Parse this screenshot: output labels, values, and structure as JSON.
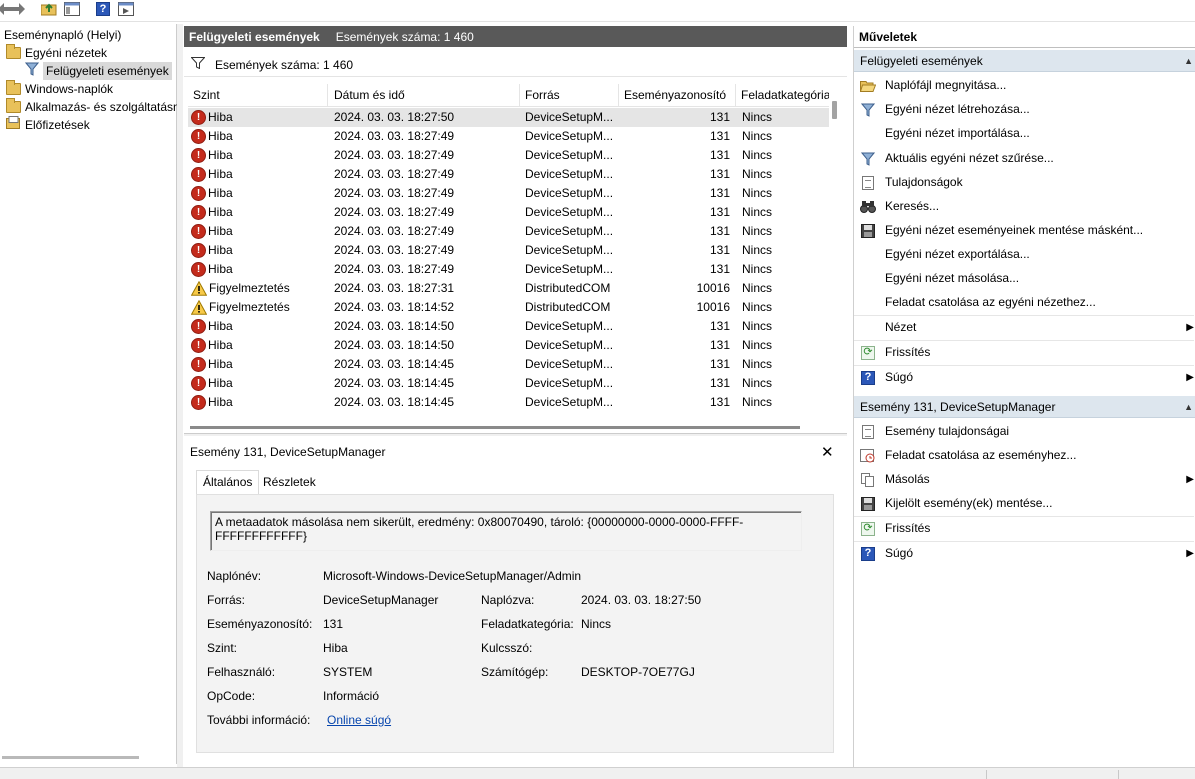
{
  "tree": {
    "items": [
      {
        "label": "Eseménynapló (Helyi)"
      },
      {
        "label": "Egyéni nézetek"
      },
      {
        "label": "Felügyeleti események"
      },
      {
        "label": "Windows-naplók"
      },
      {
        "label": "Alkalmazás- és szolgáltatásn"
      },
      {
        "label": "Előfizetések"
      }
    ]
  },
  "center": {
    "title": "Felügyeleti események",
    "count": "Események száma: 1 460",
    "filter_text": "Események száma: 1 460"
  },
  "events": {
    "columns": [
      "Szint",
      "Dátum és idő",
      "Forrás",
      "Eseményazonosító",
      "Feladatkategória"
    ],
    "rows": [
      {
        "level": "Hiba",
        "type": "error",
        "date": "2024. 03. 03. 18:27:50",
        "source": "DeviceSetupM...",
        "id": "131",
        "task": "Nincs"
      },
      {
        "level": "Hiba",
        "type": "error",
        "date": "2024. 03. 03. 18:27:49",
        "source": "DeviceSetupM...",
        "id": "131",
        "task": "Nincs"
      },
      {
        "level": "Hiba",
        "type": "error",
        "date": "2024. 03. 03. 18:27:49",
        "source": "DeviceSetupM...",
        "id": "131",
        "task": "Nincs"
      },
      {
        "level": "Hiba",
        "type": "error",
        "date": "2024. 03. 03. 18:27:49",
        "source": "DeviceSetupM...",
        "id": "131",
        "task": "Nincs"
      },
      {
        "level": "Hiba",
        "type": "error",
        "date": "2024. 03. 03. 18:27:49",
        "source": "DeviceSetupM...",
        "id": "131",
        "task": "Nincs"
      },
      {
        "level": "Hiba",
        "type": "error",
        "date": "2024. 03. 03. 18:27:49",
        "source": "DeviceSetupM...",
        "id": "131",
        "task": "Nincs"
      },
      {
        "level": "Hiba",
        "type": "error",
        "date": "2024. 03. 03. 18:27:49",
        "source": "DeviceSetupM...",
        "id": "131",
        "task": "Nincs"
      },
      {
        "level": "Hiba",
        "type": "error",
        "date": "2024. 03. 03. 18:27:49",
        "source": "DeviceSetupM...",
        "id": "131",
        "task": "Nincs"
      },
      {
        "level": "Hiba",
        "type": "error",
        "date": "2024. 03. 03. 18:27:49",
        "source": "DeviceSetupM...",
        "id": "131",
        "task": "Nincs"
      },
      {
        "level": "Figyelmeztetés",
        "type": "warning",
        "date": "2024. 03. 03. 18:27:31",
        "source": "DistributedCOM",
        "id": "10016",
        "task": "Nincs"
      },
      {
        "level": "Figyelmeztetés",
        "type": "warning",
        "date": "2024. 03. 03. 18:14:52",
        "source": "DistributedCOM",
        "id": "10016",
        "task": "Nincs"
      },
      {
        "level": "Hiba",
        "type": "error",
        "date": "2024. 03. 03. 18:14:50",
        "source": "DeviceSetupM...",
        "id": "131",
        "task": "Nincs"
      },
      {
        "level": "Hiba",
        "type": "error",
        "date": "2024. 03. 03. 18:14:50",
        "source": "DeviceSetupM...",
        "id": "131",
        "task": "Nincs"
      },
      {
        "level": "Hiba",
        "type": "error",
        "date": "2024. 03. 03. 18:14:45",
        "source": "DeviceSetupM...",
        "id": "131",
        "task": "Nincs"
      },
      {
        "level": "Hiba",
        "type": "error",
        "date": "2024. 03. 03. 18:14:45",
        "source": "DeviceSetupM...",
        "id": "131",
        "task": "Nincs"
      },
      {
        "level": "Hiba",
        "type": "error",
        "date": "2024. 03. 03. 18:14:45",
        "source": "DeviceSetupM...",
        "id": "131",
        "task": "Nincs"
      }
    ]
  },
  "detail": {
    "title": "Esemény 131, DeviceSetupManager",
    "tabs": [
      "Általános",
      "Részletek"
    ],
    "message": "A metaadatok másolása nem sikerült, eredmény: 0x80070490, tároló: {00000000-0000-0000-FFFF-FFFFFFFFFFFF}",
    "fields": {
      "log_label": "Naplónév:",
      "log_value": "Microsoft-Windows-DeviceSetupManager/Admin",
      "source_label": "Forrás:",
      "source_value": "DeviceSetupManager",
      "logged_label": "Naplózva:",
      "logged_value": "2024. 03. 03. 18:27:50",
      "id_label": "Eseményazonosító:",
      "id_value": "131",
      "task_label": "Feladatkategória:",
      "task_value": "Nincs",
      "level_label": "Szint:",
      "level_value": "Hiba",
      "keywords_label": "Kulcsszó:",
      "user_label": "Felhasználó:",
      "user_value": "SYSTEM",
      "computer_label": "Számítógép:",
      "computer_value": "DESKTOP-7OE77GJ",
      "opcode_label": "OpCode:",
      "opcode_value": "Információ",
      "more_label": "További információ:",
      "more_link": "Online súgó"
    }
  },
  "actions": {
    "title": "Műveletek",
    "section1": {
      "title": "Felügyeleti események",
      "items": [
        {
          "label": "Naplófájl megnyitása...",
          "icon": "folder-open-icon"
        },
        {
          "label": "Egyéni nézet létrehozása...",
          "icon": "filter-icon"
        },
        {
          "label": "Egyéni nézet importálása...",
          "icon": ""
        },
        {
          "label": "Aktuális egyéni nézet szűrése...",
          "icon": "filter-icon"
        },
        {
          "label": "Tulajdonságok",
          "icon": "properties-icon"
        },
        {
          "label": "Keresés...",
          "icon": "binoculars-icon"
        },
        {
          "label": "Egyéni nézet eseményeinek mentése másként...",
          "icon": "save-icon"
        },
        {
          "label": "Egyéni nézet exportálása...",
          "icon": ""
        },
        {
          "label": "Egyéni nézet másolása...",
          "icon": ""
        },
        {
          "label": "Feladat csatolása az egyéni nézethez...",
          "icon": ""
        },
        {
          "label": "Nézet",
          "icon": ""
        },
        {
          "label": "Frissítés",
          "icon": "refresh-icon"
        },
        {
          "label": "Súgó",
          "icon": "help-icon"
        }
      ]
    },
    "section2": {
      "title": "Esemény 131, DeviceSetupManager",
      "items": [
        {
          "label": "Esemény tulajdonságai",
          "icon": "properties-icon"
        },
        {
          "label": "Feladat csatolása az eseményhez...",
          "icon": "task-icon"
        },
        {
          "label": "Másolás",
          "icon": "copy-icon"
        },
        {
          "label": "Kijelölt esemény(ek) mentése...",
          "icon": "save-icon"
        },
        {
          "label": "Frissítés",
          "icon": "refresh-icon"
        },
        {
          "label": "Súgó",
          "icon": "help-icon"
        }
      ]
    }
  }
}
